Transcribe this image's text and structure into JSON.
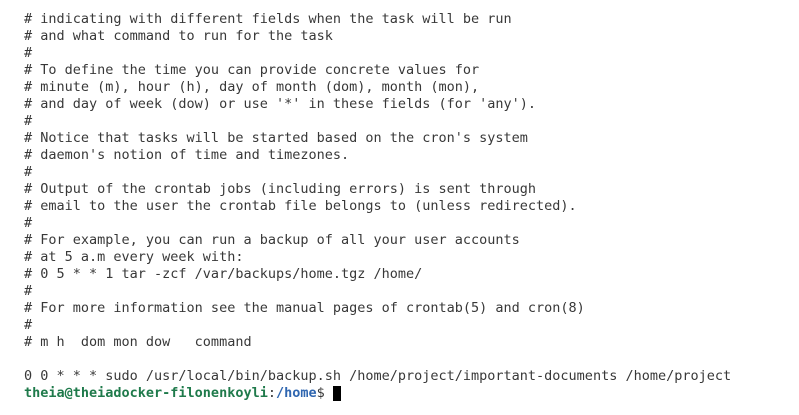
{
  "terminal": {
    "lines": [
      "# indicating with different fields when the task will be run",
      "# and what command to run for the task",
      "#",
      "# To define the time you can provide concrete values for",
      "# minute (m), hour (h), day of month (dom), month (mon),",
      "# and day of week (dow) or use '*' in these fields (for 'any').",
      "#",
      "# Notice that tasks will be started based on the cron's system",
      "# daemon's notion of time and timezones.",
      "#",
      "# Output of the crontab jobs (including errors) is sent through",
      "# email to the user the crontab file belongs to (unless redirected).",
      "#",
      "# For example, you can run a backup of all your user accounts",
      "# at 5 a.m every week with:",
      "# 0 5 * * 1 tar -zcf /var/backups/home.tgz /home/",
      "#",
      "# For more information see the manual pages of crontab(5) and cron(8)",
      "#",
      "# m h  dom mon dow   command",
      "",
      "0 0 * * * sudo /usr/local/bin/backup.sh /home/project/important-documents /home/project"
    ],
    "prompt": {
      "user_host": "theia@theiadocker-filonenkoyli",
      "separator": ":",
      "path": "/home",
      "symbol": "$"
    },
    "colors": {
      "background": "#ffffff",
      "text": "#383838",
      "prompt_user": "#1f7a4b",
      "prompt_path": "#2f66b0",
      "cursor": "#000000"
    }
  }
}
